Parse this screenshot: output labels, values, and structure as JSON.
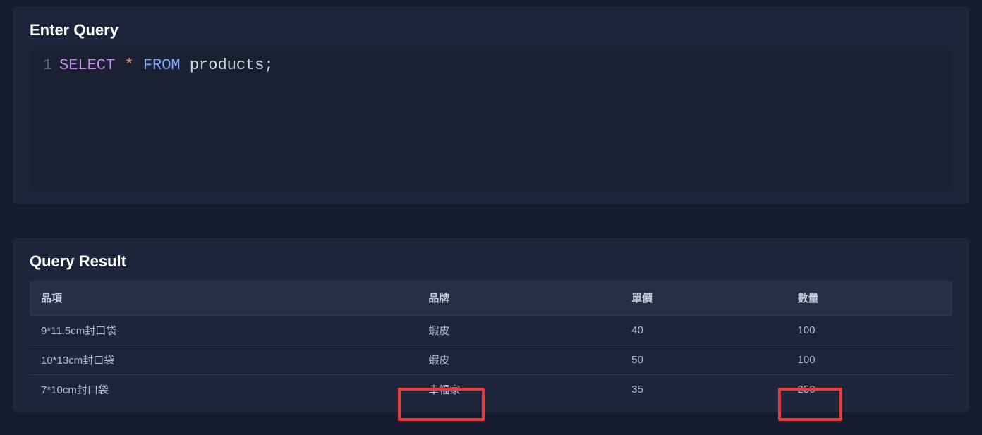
{
  "query_panel": {
    "title": "Enter Query",
    "line_number": "1",
    "tokens": {
      "select": "SELECT",
      "star": "*",
      "from": "FROM",
      "ident": "products",
      "semicolon": ";"
    }
  },
  "result_panel": {
    "title": "Query Result",
    "headers": [
      "品項",
      "品牌",
      "單價",
      "數量"
    ],
    "rows": [
      [
        "9*11.5cm封口袋",
        "蝦皮",
        "40",
        "100"
      ],
      [
        "10*13cm封口袋",
        "蝦皮",
        "50",
        "100"
      ],
      [
        "7*10cm封口袋",
        "幸福家",
        "35",
        "250"
      ]
    ]
  }
}
